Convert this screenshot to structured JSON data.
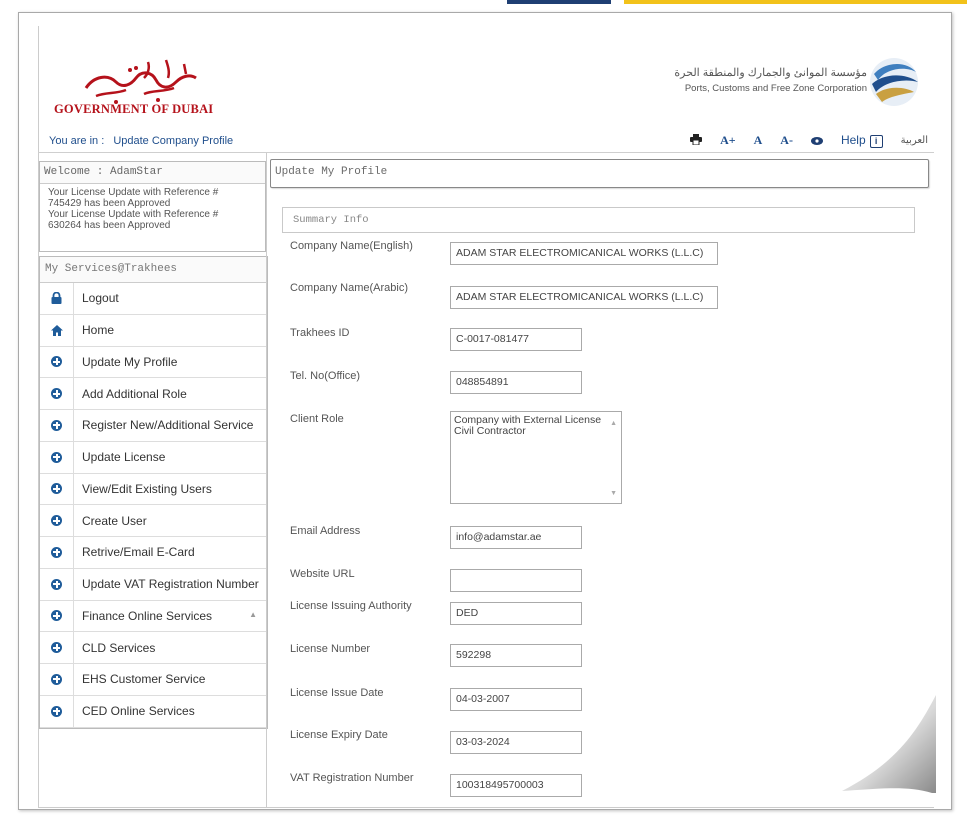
{
  "header": {
    "gov_name": "GOVERNMENT OF DUBAI",
    "corp_name_ar": "مؤسسة الموانئ والجمارك والمنطقة الحرة",
    "corp_name_en": "Ports, Customs and Free Zone Corporation"
  },
  "breadcrumb": {
    "prefix": "You are in :",
    "current": "Update Company Profile"
  },
  "toolbar": {
    "print_icon": "print-icon",
    "font_increase": "A+",
    "font_normal": "A",
    "font_decrease": "A-",
    "view_icon": "eye-icon",
    "help_label": "Help",
    "help_icon_glyph": "i",
    "arabic_label": "العربية"
  },
  "welcome": {
    "title": "Welcome : AdamStar",
    "message_lines": [
      "Your License Update with Reference #",
      "745429 has been Approved",
      "Your License Update with Reference #",
      "630264 has been Approved"
    ]
  },
  "services": {
    "title": "My Services@Trakhees",
    "items": [
      {
        "label": "Logout",
        "icon": "lock-icon"
      },
      {
        "label": "Home",
        "icon": "home-icon"
      },
      {
        "label": "Update My Profile",
        "icon": "plus-circle-icon"
      },
      {
        "label": "Add Additional Role",
        "icon": "plus-circle-icon"
      },
      {
        "label": "Register New/Additional Service",
        "icon": "plus-circle-icon"
      },
      {
        "label": "Update License",
        "icon": "plus-circle-icon"
      },
      {
        "label": "View/Edit Existing Users",
        "icon": "plus-circle-icon"
      },
      {
        "label": "Create User",
        "icon": "plus-circle-icon"
      },
      {
        "label": "Retrive/Email E-Card",
        "icon": "plus-circle-icon"
      },
      {
        "label": "Update VAT Registration Number",
        "icon": "plus-circle-icon"
      },
      {
        "label": "Finance Online Services",
        "icon": "plus-circle-icon"
      },
      {
        "label": "CLD Services",
        "icon": "plus-circle-icon"
      },
      {
        "label": "EHS Customer Service",
        "icon": "plus-circle-icon"
      },
      {
        "label": "CED Online Services",
        "icon": "plus-circle-icon"
      }
    ]
  },
  "main": {
    "title": "Update My Profile",
    "section": "Summary Info",
    "fields": {
      "company_name_en": {
        "label": "Company Name(English)",
        "value": "ADAM STAR ELECTROMICANICAL WORKS (L.L.C)"
      },
      "company_name_ar": {
        "label": "Company Name(Arabic)",
        "value": "ADAM STAR ELECTROMICANICAL WORKS (L.L.C)"
      },
      "trakhees_id": {
        "label": "Trakhees ID",
        "value": "C-0017-081477"
      },
      "tel_office": {
        "label": "Tel. No(Office)",
        "value": "048854891"
      },
      "client_role": {
        "label": "Client Role",
        "values": [
          "Company with External License",
          "Civil Contractor"
        ]
      },
      "email": {
        "label": "Email Address",
        "value": "info@adamstar.ae"
      },
      "website": {
        "label": "Website URL",
        "value": ""
      },
      "license_authority": {
        "label": "License Issuing Authority",
        "value": "DED"
      },
      "license_number": {
        "label": "License Number",
        "value": "592298"
      },
      "license_issue_date": {
        "label": "License Issue Date",
        "value": "04-03-2007"
      },
      "license_expiry_date": {
        "label": "License Expiry Date",
        "value": "03-03-2024"
      },
      "vat_number": {
        "label": "VAT Registration Number",
        "value": "100318495700003"
      }
    }
  },
  "colors": {
    "gov_red": "#b5121b",
    "link_blue": "#1f4e8c",
    "icon_blue": "#1f5c9a",
    "top_gold": "#f2c21a",
    "top_navy": "#1f3f73"
  }
}
